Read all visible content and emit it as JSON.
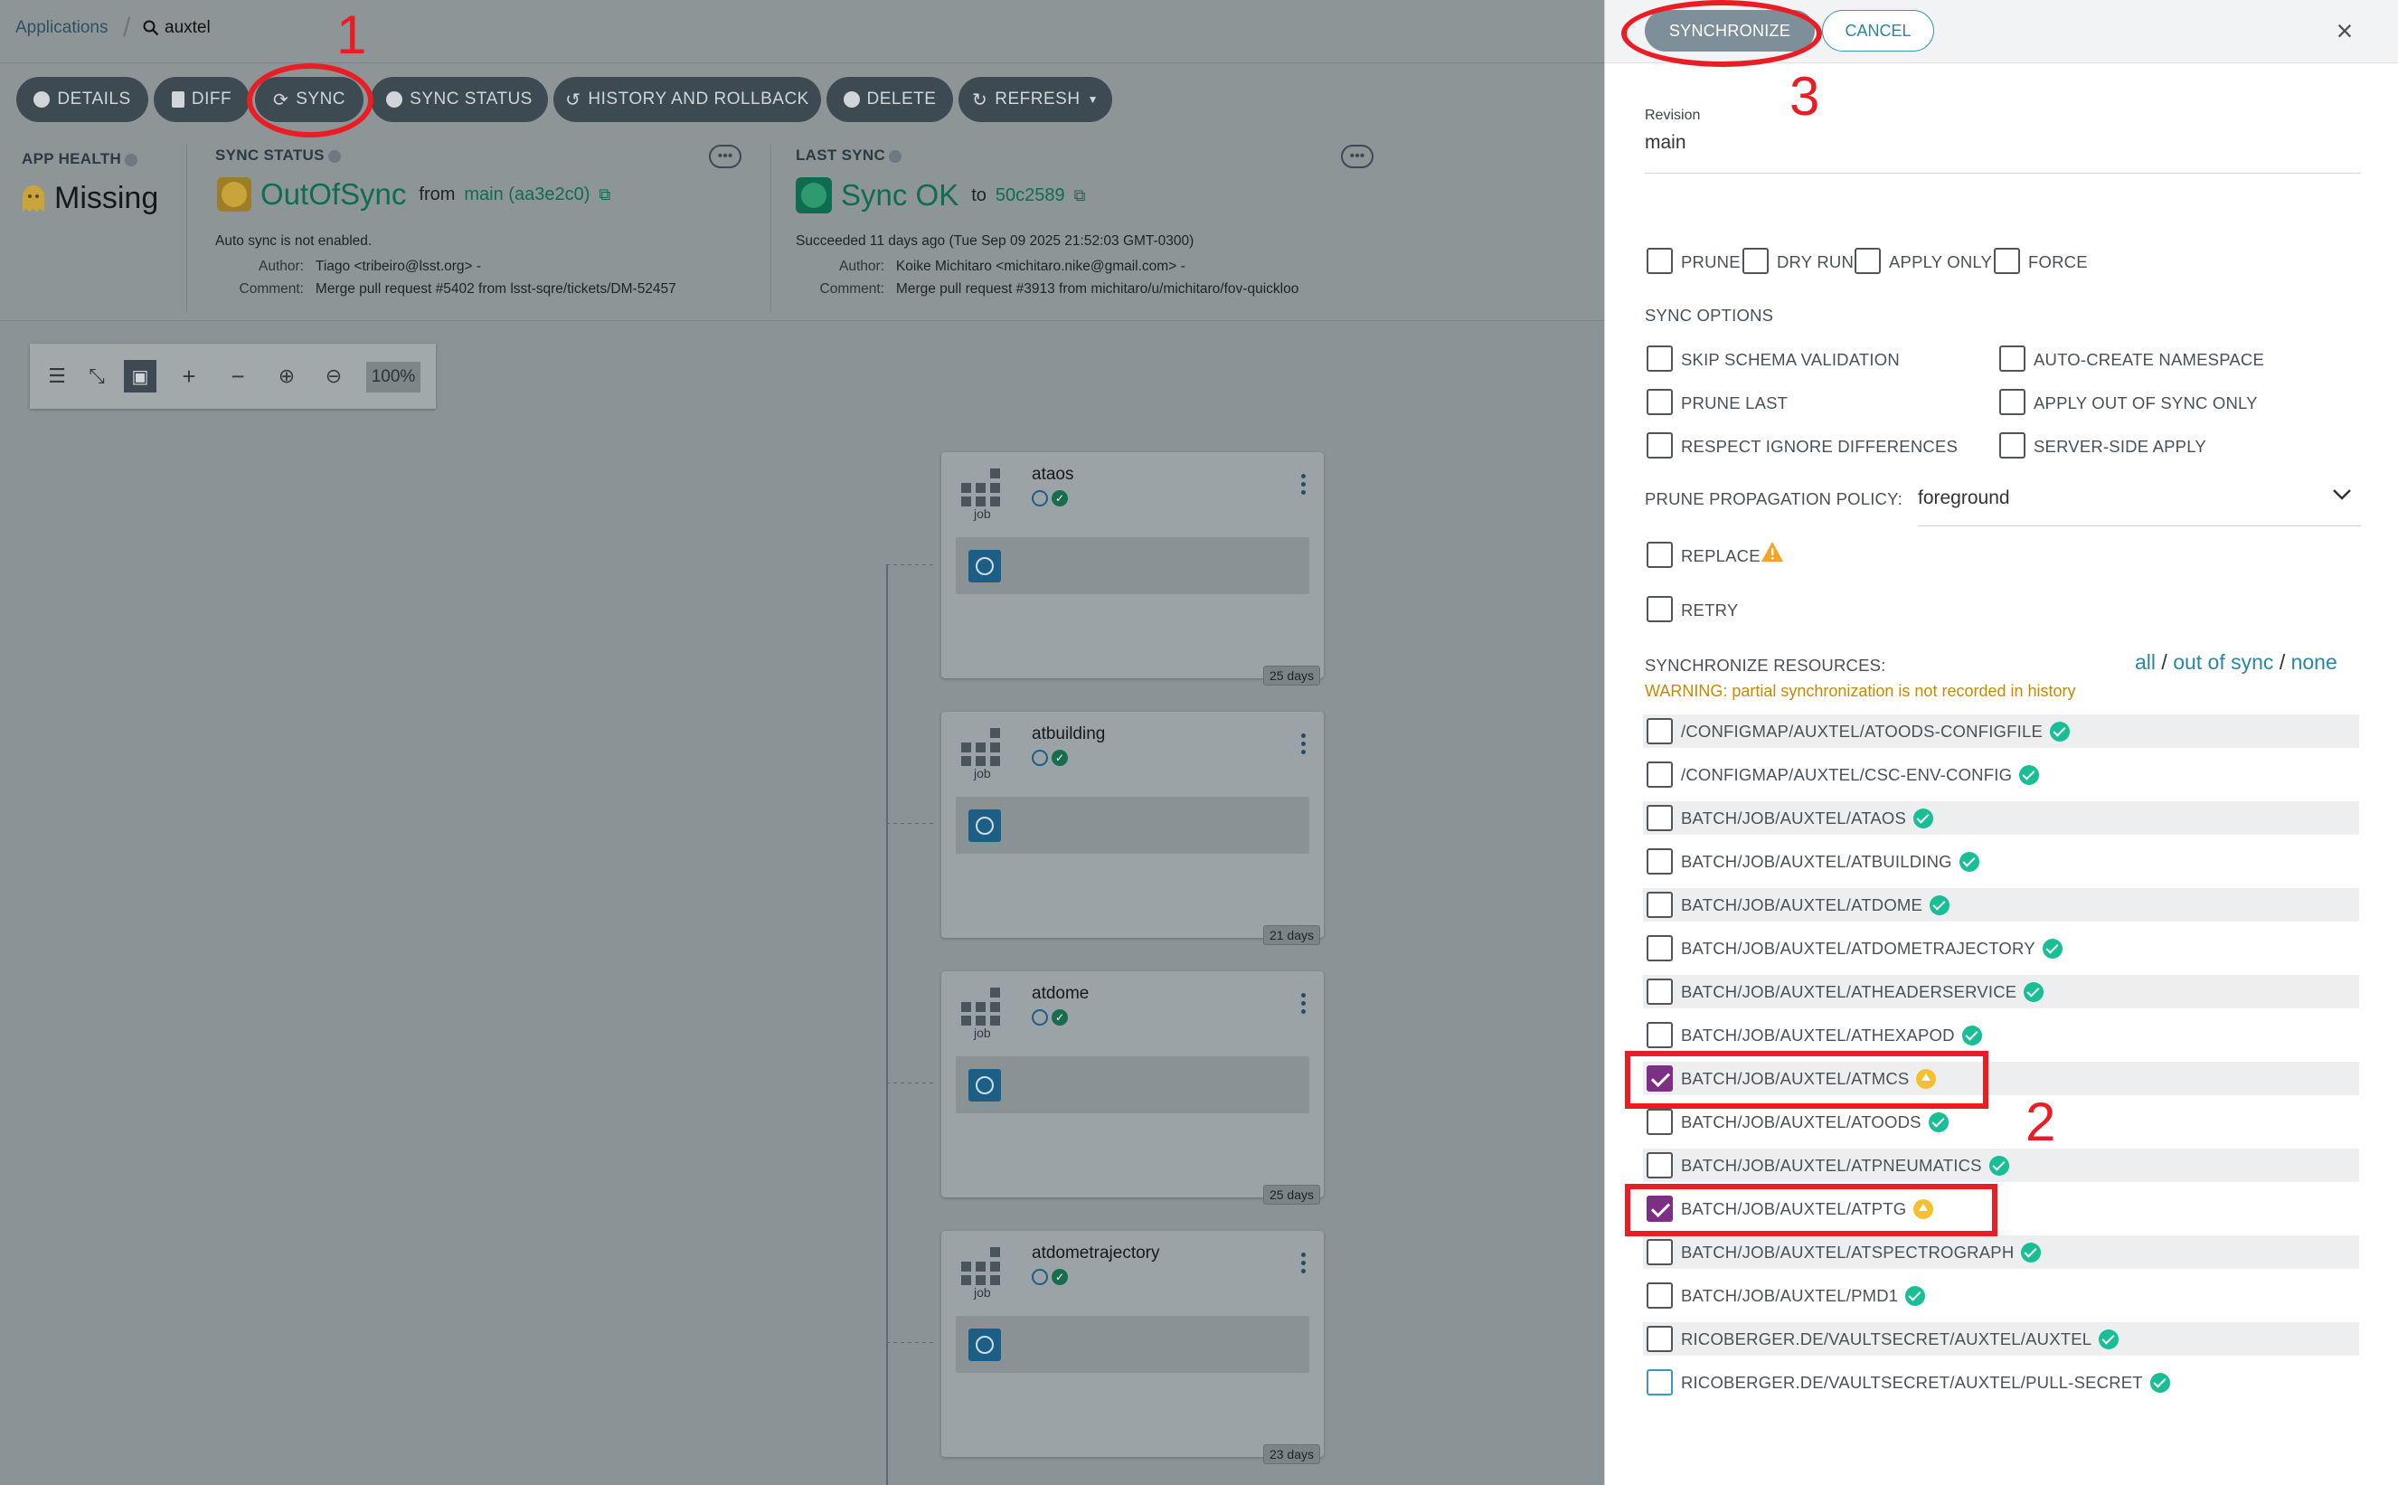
{
  "breadcrumb": {
    "applications": "Applications",
    "app": "auxtel"
  },
  "toolbar": {
    "details": "DETAILS",
    "diff": "DIFF",
    "sync": "SYNC",
    "sync_status": "SYNC STATUS",
    "history": "HISTORY AND ROLLBACK",
    "delete": "DELETE",
    "refresh": "REFRESH"
  },
  "summary": {
    "health_title": "APP HEALTH",
    "health_value": "Missing",
    "sync_title": "SYNC STATUS",
    "sync_value": "OutOfSync",
    "from_word": "from",
    "from_rev": "main (aa3e2c0)",
    "auto_sync": "Auto sync is not enabled.",
    "author_label": "Author:",
    "author": "Tiago <tribeiro@lsst.org> -",
    "comment_label": "Comment:",
    "comment": "Merge pull request #5402 from lsst-sqre/tickets/DM-52457",
    "last_title": "LAST SYNC",
    "last_value": "Sync OK",
    "to_word": "to",
    "to_rev": "50c2589",
    "succeeded": "Succeeded 11 days ago (Tue Sep 09 2025 21:52:03 GMT-0300)",
    "last_author": "Koike Michitaro <michitaro.nike@gmail.com> -",
    "last_comment": "Merge pull request #3913 from michitaro/u/michitaro/fov-quickloo"
  },
  "zoom": {
    "percent": "100%"
  },
  "nodes": [
    {
      "name": "ataos",
      "kind": "job",
      "age": "25 days"
    },
    {
      "name": "atbuilding",
      "kind": "job",
      "age": "21 days"
    },
    {
      "name": "atdome",
      "kind": "job",
      "age": "25 days"
    },
    {
      "name": "atdometrajectory",
      "kind": "job",
      "age": "23 days"
    }
  ],
  "panel": {
    "synchronize": "SYNCHRONIZE",
    "cancel": "CANCEL",
    "revision_label": "Revision",
    "revision": "main",
    "prune": "PRUNE",
    "dry_run": "DRY RUN",
    "apply_only": "APPLY ONLY",
    "force": "FORCE",
    "sync_options_title": "SYNC OPTIONS",
    "skip_schema": "SKIP SCHEMA VALIDATION",
    "auto_create_ns": "AUTO-CREATE NAMESPACE",
    "prune_last": "PRUNE LAST",
    "apply_oos_only": "APPLY OUT OF SYNC ONLY",
    "respect_ignore": "RESPECT IGNORE DIFFERENCES",
    "server_side": "SERVER-SIDE APPLY",
    "ppp_label": "PRUNE PROPAGATION POLICY:",
    "ppp_value": "foreground",
    "replace": "REPLACE",
    "retry": "RETRY",
    "resources_title": "SYNCHRONIZE RESOURCES:",
    "sel_all": "all",
    "sel_oos": "out of sync",
    "sel_none": "none",
    "slash": "/",
    "warning": "WARNING: partial synchronization is not recorded in history",
    "resources": [
      {
        "label": "/CONFIGMAP/AUXTEL/ATOODS-CONFIGFILE",
        "checked": false,
        "status": "synced"
      },
      {
        "label": "/CONFIGMAP/AUXTEL/CSC-ENV-CONFIG",
        "checked": false,
        "status": "synced"
      },
      {
        "label": "BATCH/JOB/AUXTEL/ATAOS",
        "checked": false,
        "status": "synced"
      },
      {
        "label": "BATCH/JOB/AUXTEL/ATBUILDING",
        "checked": false,
        "status": "synced"
      },
      {
        "label": "BATCH/JOB/AUXTEL/ATDOME",
        "checked": false,
        "status": "synced"
      },
      {
        "label": "BATCH/JOB/AUXTEL/ATDOMETRAJECTORY",
        "checked": false,
        "status": "synced"
      },
      {
        "label": "BATCH/JOB/AUXTEL/ATHEADERSERVICE",
        "checked": false,
        "status": "synced"
      },
      {
        "label": "BATCH/JOB/AUXTEL/ATHEXAPOD",
        "checked": false,
        "status": "synced"
      },
      {
        "label": "BATCH/JOB/AUXTEL/ATMCS",
        "checked": true,
        "status": "outofsync"
      },
      {
        "label": "BATCH/JOB/AUXTEL/ATOODS",
        "checked": false,
        "status": "synced"
      },
      {
        "label": "BATCH/JOB/AUXTEL/ATPNEUMATICS",
        "checked": false,
        "status": "synced"
      },
      {
        "label": "BATCH/JOB/AUXTEL/ATPTG",
        "checked": true,
        "status": "outofsync"
      },
      {
        "label": "BATCH/JOB/AUXTEL/ATSPECTROGRAPH",
        "checked": false,
        "status": "synced"
      },
      {
        "label": "BATCH/JOB/AUXTEL/PMD1",
        "checked": false,
        "status": "synced"
      },
      {
        "label": "RICOBERGER.DE/VAULTSECRET/AUXTEL/AUXTEL",
        "checked": false,
        "status": "synced"
      },
      {
        "label": "RICOBERGER.DE/VAULTSECRET/AUXTEL/PULL-SECRET",
        "checked": false,
        "status": "synced"
      }
    ]
  },
  "annotations": {
    "step1": "1",
    "step2": "2",
    "step3": "3",
    "color": "#ea1d25"
  },
  "colors": {
    "accent": "#2a87a3",
    "synced": "#18be94",
    "outofsync": "#f4c030",
    "checked": "#7d2f86"
  }
}
